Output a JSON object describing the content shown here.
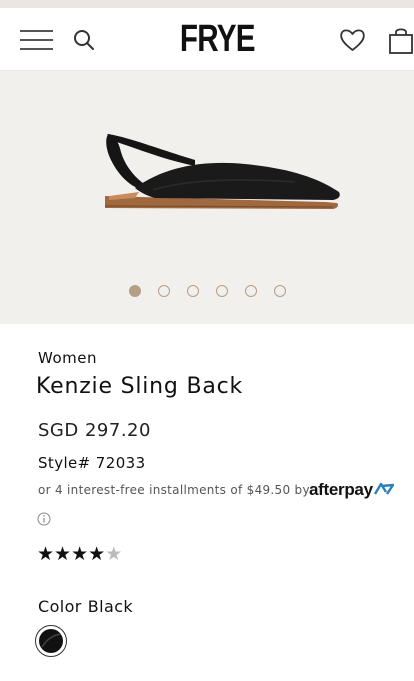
{
  "header": {
    "logo": "FRYE",
    "menu_icon": "hamburger-menu-icon",
    "search_icon": "search-icon",
    "wishlist_icon": "heart-icon",
    "cart_icon": "shopping-bag-icon"
  },
  "gallery": {
    "image": "black-slingback-flat-shoe",
    "dot_count": 6,
    "active_index": 0
  },
  "product": {
    "category": "Women",
    "name": "Kenzie Sling Back",
    "price": "SGD 297.20",
    "style": "Style# 72033",
    "afterpay_text": "or 4 interest-free installments of $49.50 by",
    "afterpay_brand": "afterpay",
    "rating": {
      "value": 4,
      "max": 5
    },
    "color_label": "Color",
    "color_value": "Black"
  },
  "colors": {
    "accent": "#b49e86",
    "hero_bg": "#f2f0ed",
    "swatch": "#111111"
  }
}
